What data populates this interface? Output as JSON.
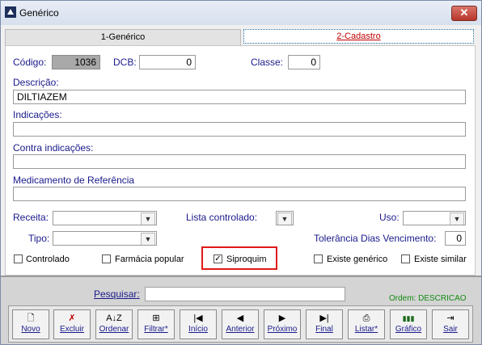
{
  "window": {
    "title": "Genérico",
    "close_label": "✕"
  },
  "tabs": [
    {
      "label": "1-Genérico"
    },
    {
      "label": "2-Cadastro"
    }
  ],
  "form": {
    "codigo_label": "Código:",
    "codigo_value": "1036",
    "dcb_label": "DCB:",
    "dcb_value": "0",
    "classe_label": "Classe:",
    "classe_value": "0",
    "descricao_label": "Descrição:",
    "descricao_value": "DILTIAZEM",
    "indicacoes_label": "Indicações:",
    "indicacoes_value": "",
    "contra_label": "Contra indicações:",
    "contra_value": "",
    "medref_label": "Medicamento de Referência",
    "medref_value": "",
    "receita_label": "Receita:",
    "receita_value": "",
    "lista_label": "Lista controlado:",
    "lista_value": "",
    "uso_label": "Uso:",
    "uso_value": "",
    "tipo_label": "Tipo:",
    "tipo_value": "",
    "tolerancia_label": "Tolerância Dias Vencimento:",
    "tolerancia_value": "0"
  },
  "checkboxes": [
    {
      "label": "Controlado",
      "checked": false
    },
    {
      "label": "Farmácia popular",
      "checked": false
    },
    {
      "label": "Siproquim",
      "checked": true
    },
    {
      "label": "Existe genérico",
      "checked": false
    },
    {
      "label": "Existe similar",
      "checked": false
    }
  ],
  "search": {
    "label": "Pesquisar:",
    "value": "",
    "ordem": "Ordem: DESCRICAO"
  },
  "toolbar": [
    {
      "label": "Novo",
      "icon": "new-doc-icon",
      "glyph": "🗋"
    },
    {
      "label": "Excluir",
      "icon": "delete-x-icon",
      "glyph": "✗"
    },
    {
      "label": "Ordenar",
      "icon": "sort-az-icon",
      "glyph": "A↓Z"
    },
    {
      "label": "Filtrar*",
      "icon": "filter-icon",
      "glyph": "⊞"
    },
    {
      "label": "Início",
      "icon": "first-record-icon",
      "glyph": "|◀"
    },
    {
      "label": "Anterior",
      "icon": "previous-record-icon",
      "glyph": "◀"
    },
    {
      "label": "Próximo",
      "icon": "next-record-icon",
      "glyph": "▶"
    },
    {
      "label": "Final",
      "icon": "last-record-icon",
      "glyph": "▶|"
    },
    {
      "label": "Listar*",
      "icon": "printer-icon",
      "glyph": "⎙"
    },
    {
      "label": "Gráfico",
      "icon": "chart-icon",
      "glyph": "▮▮▮"
    },
    {
      "label": "Sair",
      "icon": "exit-icon",
      "glyph": "⇥"
    }
  ],
  "colors": {
    "label": "#1a1a8c",
    "active_tab_text": "#c00000",
    "highlight": "#e01818",
    "ordem": "#118a11"
  }
}
